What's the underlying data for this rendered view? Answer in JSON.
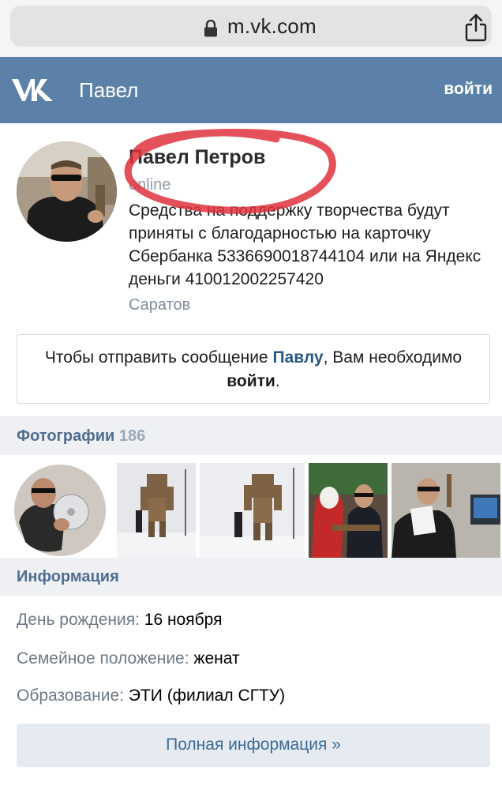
{
  "browser": {
    "url": "m.vk.com"
  },
  "header": {
    "title": "Павел",
    "login": "войти"
  },
  "profile": {
    "name": "Павел Петров",
    "online": "online",
    "status": "Средства на поддержку творчества будут приняты с благодарностью на карточку Сбербанка 5336690018744104 или на Яндекс деньги 410012002257420",
    "city": "Саратов",
    "message": {
      "prefix": "Чтобы отправить сообщение ",
      "name_link": "Павлу",
      "middle": ", Вам необходимо ",
      "login_word": "войти",
      "suffix": "."
    }
  },
  "photos": {
    "title": "Фотографии",
    "count": "186"
  },
  "info": {
    "title": "Информация",
    "rows": [
      {
        "key": "День рождения:",
        "value": "16 ноября"
      },
      {
        "key": "Семейное положение:",
        "value": "женат"
      },
      {
        "key": "Образование:",
        "value": "ЭТИ (филиал СГТУ)"
      }
    ],
    "full_button": "Полная информация »"
  },
  "colors": {
    "vk_header": "#5b81a8",
    "link": "#2a5885",
    "section_bg": "#eef0f3",
    "annotation_red": "#e0333d"
  },
  "icons": [
    "lock-icon",
    "share-icon",
    "vk-logo"
  ]
}
